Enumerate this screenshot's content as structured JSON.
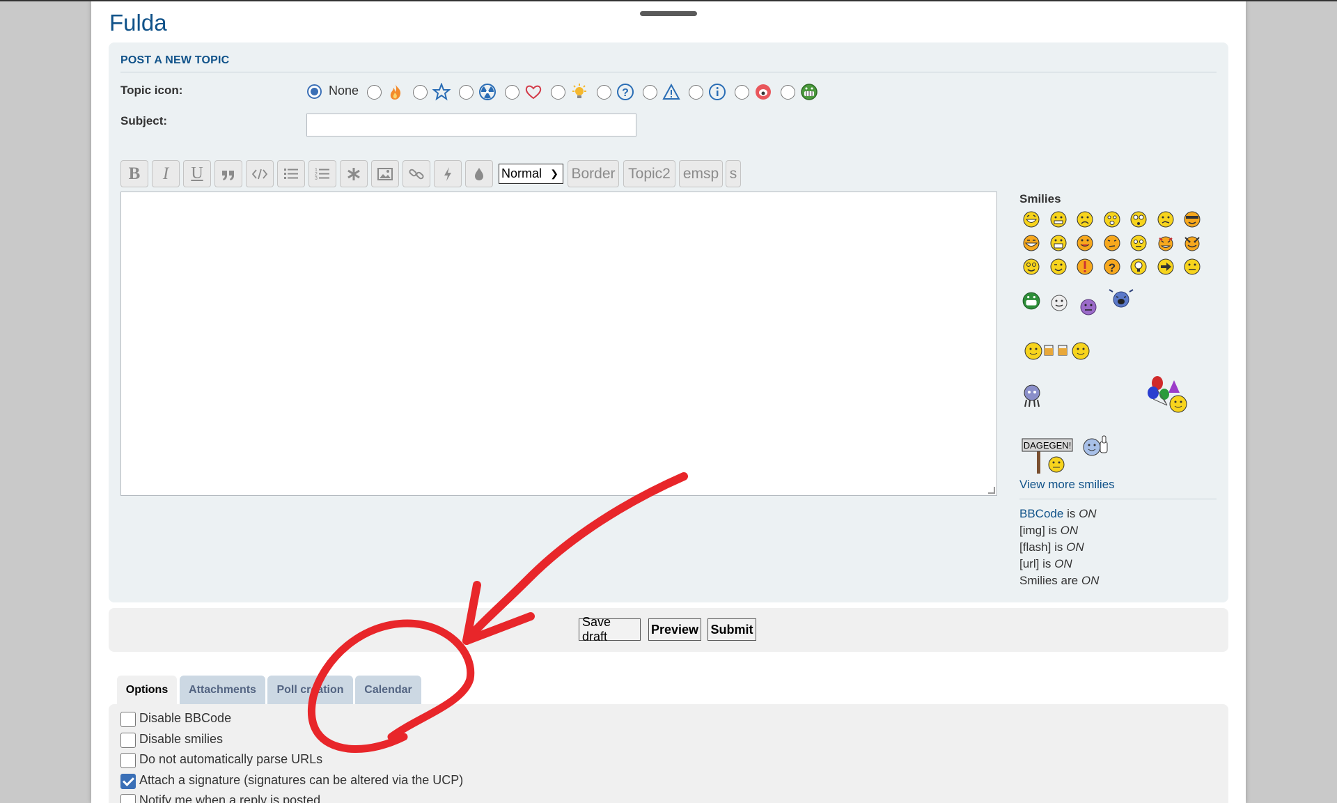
{
  "forum": {
    "title": "Fulda"
  },
  "post_panel": {
    "heading": "POST A NEW TOPIC",
    "topic_icon_label": "Topic icon:",
    "topic_icon_none": "None",
    "subject_label": "Subject:",
    "subject_value": "",
    "topic_icons": [
      "fire-icon",
      "star-icon",
      "radioactive-icon",
      "heart-icon",
      "bulb-icon",
      "question-icon",
      "warning-icon",
      "info-icon",
      "mad-face-icon",
      "grin-face-icon"
    ]
  },
  "toolbar": {
    "buttons": [
      "bold",
      "italic",
      "underline",
      "quote",
      "code",
      "list",
      "list-numbered",
      "list-item",
      "image",
      "link",
      "flash",
      "color"
    ],
    "size_value": "Normal",
    "border_label": "Border",
    "topic2_label": "Topic2",
    "emsp_label": "emsp",
    "s_label": "s"
  },
  "message": {
    "value": ""
  },
  "smilies": {
    "title": "Smilies",
    "view_more": "View more smilies",
    "sign_text": "DAGEGEN!"
  },
  "status": {
    "bbcode_link": "BBCode",
    "is": "is",
    "are": "are",
    "on": "ON",
    "img": "[img]",
    "flash": "[flash]",
    "url": "[url]",
    "smilies": "Smilies"
  },
  "submit_bar": {
    "save_draft": "Save draft",
    "preview": "Preview",
    "submit": "Submit"
  },
  "tabs": [
    "Options",
    "Attachments",
    "Poll creation",
    "Calendar"
  ],
  "options": [
    {
      "label": "Disable BBCode",
      "checked": false
    },
    {
      "label": "Disable smilies",
      "checked": false
    },
    {
      "label": "Do not automatically parse URLs",
      "checked": false
    },
    {
      "label": "Attach a signature (signatures can be altered via the UCP)",
      "checked": true
    },
    {
      "label": "Notify me when a reply is posted",
      "checked": false
    }
  ],
  "colors": {
    "link": "#105289",
    "panel": "#ecf1f3",
    "tab": "#ccd8e3",
    "annotation": "#e8262a"
  }
}
